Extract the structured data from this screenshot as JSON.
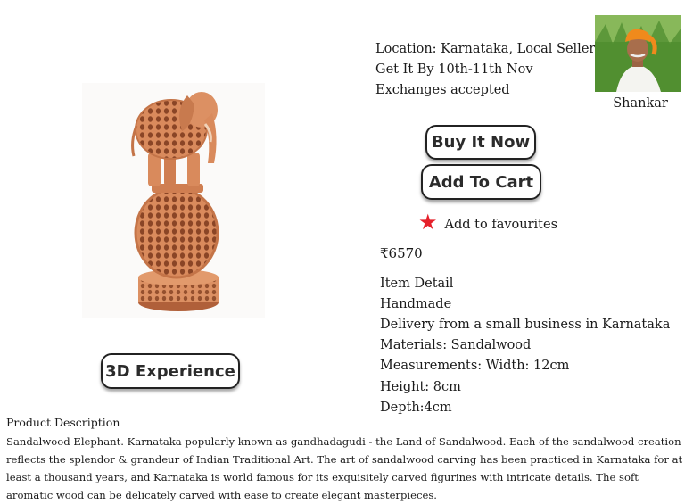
{
  "product": {
    "image_alt": "Sandalwood elephant standing on a carved lattice ball"
  },
  "actions": {
    "experience_label": "3D Experience",
    "buy_label": "Buy It Now",
    "cart_label": "Add To Cart",
    "favourite_label": "Add to favourites"
  },
  "seller": {
    "location": "Location: Karnataka, Local Seller",
    "delivery": "Get It By 10th-11th Nov",
    "exchange": "Exchanges accepted",
    "name": "Shankar"
  },
  "price": "₹6570",
  "details": [
    "Item Detail",
    "Handmade",
    "Delivery from a small business in Karnataka",
    "Materials: Sandalwood",
    "Measurements: Width: 12cm",
    "Height: 8cm",
    "Depth:4cm"
  ],
  "description": {
    "title": "Product Description",
    "body": "Sandalwood Elephant. Karnataka popularly known as gandhadagudi - the Land of Sandalwood. Each of the sandalwood creation reflects the splendor & grandeur of Indian Traditional Art. The art of sandalwood carving has been practiced in Karnataka for at least a thousand years, and Karnataka is world famous for its exquisitely carved figurines with intricate details. The soft aromatic wood can be delicately carved with ease to create elegant masterpieces."
  },
  "colors": {
    "wood": "#d98a5c",
    "wood_dark": "#b0603a",
    "favourite_star": "#e5202a"
  }
}
